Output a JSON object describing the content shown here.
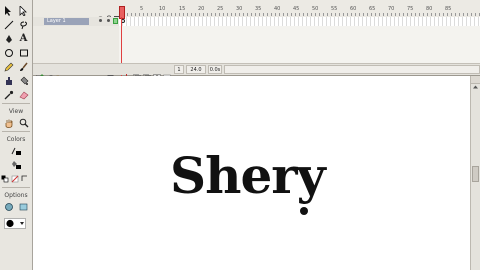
{
  "tools": {
    "view_label": "View",
    "colors_label": "Colors",
    "options_label": "Options",
    "text_tool_label": "A"
  },
  "timeline": {
    "frame_numbers": [
      "5",
      "10",
      "15",
      "20",
      "25",
      "30",
      "35",
      "40",
      "45",
      "50",
      "55",
      "60",
      "65",
      "70",
      "75",
      "80",
      "85"
    ],
    "layer_name": "Layer 1",
    "current_frame": "1",
    "frame_rate": "24.0 fps",
    "elapsed_time": "0.0s"
  },
  "stage": {
    "text": "Shery"
  },
  "colors": {
    "stage_bg": "#ffffff",
    "panel_bg": "#eceae4",
    "playhead": "#e04040",
    "layer_selected": "#9aa3b8",
    "stroke_color": "#000000",
    "fill_color": "#000000"
  }
}
